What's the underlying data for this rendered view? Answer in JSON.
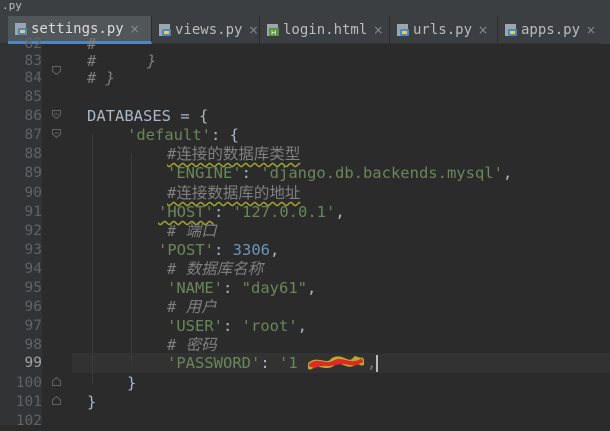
{
  "top_strip": {
    "text": ".py"
  },
  "tabs": [
    {
      "label": "settings.py",
      "icon": "python-file-icon",
      "active": true
    },
    {
      "label": "views.py",
      "icon": "python-file-icon",
      "active": false
    },
    {
      "label": "login.html",
      "icon": "html-file-icon",
      "active": false
    },
    {
      "label": "urls.py",
      "icon": "python-file-icon",
      "active": false
    },
    {
      "label": "apps.py",
      "icon": "python-file-icon",
      "active": false
    }
  ],
  "tab_close_glyph": "×",
  "line_numbers": [
    "82",
    "83",
    "84",
    "85",
    "86",
    "87",
    "88",
    "89",
    "90",
    "91",
    "92",
    "93",
    "94",
    "95",
    "96",
    "97",
    "98",
    "99",
    "100",
    "101",
    "102"
  ],
  "current_line": "99",
  "code": {
    "l82": "#",
    "l83_hash": "#",
    "l83_brace": "}",
    "l84": "# }",
    "l86": "DATABASES = {",
    "l87_key": "'default'",
    "l87_rest": ": {",
    "l88": "#连接的数据库类型",
    "l89_key": "'ENGINE'",
    "l89_sep": ": ",
    "l89_val": "'django.db.backends.mysql'",
    "l89_end": ",",
    "l90": "#连接数据库的地址",
    "l91_key": "'HOST'",
    "l91_sep": ": ",
    "l91_val": "'127.0.0.1'",
    "l91_end": ",",
    "l92": "# 端口",
    "l93_key": "'POST'",
    "l93_sep": ": ",
    "l93_val": "3306",
    "l93_end": ",",
    "l94": "# 数据库名称",
    "l95_key": "'NAME'",
    "l95_sep": ": ",
    "l95_val": "\"day61\"",
    "l95_end": ",",
    "l96": "# 用户",
    "l97_key": "'USER'",
    "l97_sep": ": ",
    "l97_val": "'root'",
    "l97_end": ",",
    "l98": "# 密码",
    "l99_key": "'PASSWORD'",
    "l99_sep": ": ",
    "l99_val": "'1",
    "l99_val_end": "',",
    "l100": "}",
    "l101": "}"
  },
  "colors": {
    "background": "#2b2b2b",
    "keyword_text": "#a9b7c6",
    "string": "#6a8759",
    "number": "#6897bb",
    "comment": "#808080",
    "active_tab_underline": "#4a88c7"
  }
}
